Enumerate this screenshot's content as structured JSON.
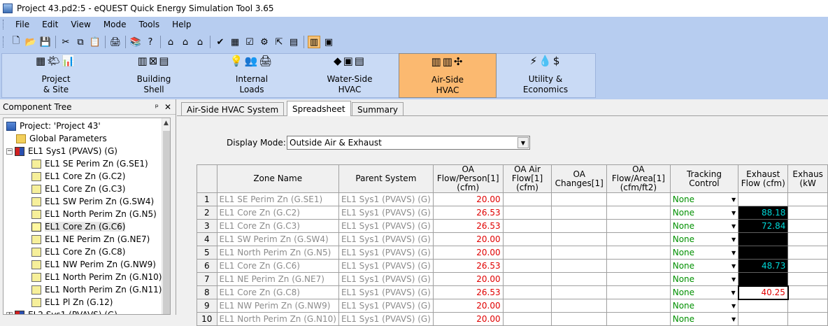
{
  "window": {
    "title": "Project 43.pd2:5 - eQUEST Quick Energy Simulation Tool 3.65"
  },
  "menu": [
    "File",
    "Edit",
    "View",
    "Mode",
    "Tools",
    "Help"
  ],
  "modes": [
    {
      "line1": "Project",
      "line2": "& Site",
      "icons": "▦🌤📊"
    },
    {
      "line1": "Building",
      "line2": "Shell",
      "icons": "▥⊠▤"
    },
    {
      "line1": "Internal",
      "line2": "Loads",
      "icons": "💡👥🖨"
    },
    {
      "line1": "Water-Side",
      "line2": "HVAC",
      "icons": "◆▣▤"
    },
    {
      "line1": "Air-Side",
      "line2": "HVAC",
      "icons": "▥▥✣"
    },
    {
      "line1": "Utility &",
      "line2": "Economics",
      "icons": "⚡💧$"
    }
  ],
  "tree": {
    "header": "Component Tree",
    "pin": "ᵖ",
    "close": "✕",
    "items": [
      {
        "label": "Project:  'Project 43'",
        "type": "proj",
        "indent": 0,
        "expander": ""
      },
      {
        "label": "Global Parameters",
        "type": "folder",
        "indent": 1,
        "expander": ""
      },
      {
        "label": "EL1 Sys1 (PVAVS) (G)",
        "type": "sys",
        "indent": 0,
        "expander": "−"
      },
      {
        "label": "EL1 SE Perim Zn (G.SE1)",
        "type": "zone",
        "indent": 2,
        "expander": ""
      },
      {
        "label": "EL1 Core Zn (G.C2)",
        "type": "zone",
        "indent": 2,
        "expander": ""
      },
      {
        "label": "EL1 Core Zn (G.C3)",
        "type": "zone",
        "indent": 2,
        "expander": ""
      },
      {
        "label": "EL1 SW Perim Zn (G.SW4)",
        "type": "zone",
        "indent": 2,
        "expander": ""
      },
      {
        "label": "EL1 North Perim Zn (G.N5)",
        "type": "zone",
        "indent": 2,
        "expander": ""
      },
      {
        "label": "EL1 Core Zn (G.C6)",
        "type": "zone",
        "indent": 2,
        "expander": "",
        "selected": true
      },
      {
        "label": "EL1 NE Perim Zn (G.NE7)",
        "type": "zone",
        "indent": 2,
        "expander": ""
      },
      {
        "label": "EL1 Core Zn (G.C8)",
        "type": "zone",
        "indent": 2,
        "expander": ""
      },
      {
        "label": "EL1 NW Perim Zn (G.NW9)",
        "type": "zone",
        "indent": 2,
        "expander": ""
      },
      {
        "label": "EL1 North Perim Zn (G.N10)",
        "type": "zone",
        "indent": 2,
        "expander": ""
      },
      {
        "label": "EL1 North Perim Zn (G.N11)",
        "type": "zone",
        "indent": 2,
        "expander": ""
      },
      {
        "label": "EL1 Pl Zn (G.12)",
        "type": "zone",
        "indent": 2,
        "expander": ""
      },
      {
        "label": "EL2 Sys1 (PVAVS) (G)",
        "type": "sys",
        "indent": 0,
        "expander": "+"
      }
    ]
  },
  "tabs": [
    {
      "label": "Air-Side HVAC System"
    },
    {
      "label": "Spreadsheet",
      "active": true
    },
    {
      "label": "Summary"
    }
  ],
  "display_mode": {
    "label": "Display Mode:",
    "value": "Outside Air & Exhaust"
  },
  "columns": [
    "",
    "Zone Name",
    "Parent System",
    "OA Flow/Person[1] (cfm)",
    "OA Air Flow[1] (cfm)",
    "OA Changes[1]",
    "OA Flow/Area[1] (cfm/ft2)",
    "Tracking Control",
    "Exhaust Flow (cfm)",
    "Exhaus (kW"
  ],
  "rows": [
    {
      "n": "1",
      "zone": "EL1 SE Perim Zn (G.SE1)",
      "parent": "EL1 Sys1 (PVAVS) (G)",
      "oap": "20.00",
      "track": "None",
      "exh": "",
      "exh_style": "lt"
    },
    {
      "n": "2",
      "zone": "EL1 Core Zn (G.C2)",
      "parent": "EL1 Sys1 (PVAVS) (G)",
      "oap": "26.53",
      "track": "None",
      "exh": "88.18",
      "exh_style": "ex"
    },
    {
      "n": "3",
      "zone": "EL1 Core Zn (G.C3)",
      "parent": "EL1 Sys1 (PVAVS) (G)",
      "oap": "26.53",
      "track": "None",
      "exh": "72.84",
      "exh_style": "ex"
    },
    {
      "n": "4",
      "zone": "EL1 SW Perim Zn (G.SW4)",
      "parent": "EL1 Sys1 (PVAVS) (G)",
      "oap": "20.00",
      "track": "None",
      "exh": "",
      "exh_style": "ex"
    },
    {
      "n": "5",
      "zone": "EL1 North Perim Zn (G.N5)",
      "parent": "EL1 Sys1 (PVAVS) (G)",
      "oap": "20.00",
      "track": "None",
      "exh": "",
      "exh_style": "ex"
    },
    {
      "n": "6",
      "zone": "EL1 Core Zn (G.C6)",
      "parent": "EL1 Sys1 (PVAVS) (G)",
      "oap": "26.53",
      "track": "None",
      "exh": "48.73",
      "exh_style": "ex"
    },
    {
      "n": "7",
      "zone": "EL1 NE Perim Zn (G.NE7)",
      "parent": "EL1 Sys1 (PVAVS) (G)",
      "oap": "20.00",
      "track": "None",
      "exh": "",
      "exh_style": "ex"
    },
    {
      "n": "8",
      "zone": "EL1 Core Zn (G.C8)",
      "parent": "EL1 Sys1 (PVAVS) (G)",
      "oap": "26.53",
      "track": "None",
      "exh": "40.25",
      "exh_style": "ex wr"
    },
    {
      "n": "9",
      "zone": "EL1 NW Perim Zn (G.NW9)",
      "parent": "EL1 Sys1 (PVAVS) (G)",
      "oap": "20.00",
      "track": "None",
      "exh": "",
      "exh_style": "lt"
    },
    {
      "n": "10",
      "zone": "EL1 North Perim Zn (G.N10)",
      "parent": "EL1 Sys1 (PVAVS) (G)",
      "oap": "20.00",
      "track": "None",
      "exh": "",
      "exh_style": "lt"
    }
  ]
}
